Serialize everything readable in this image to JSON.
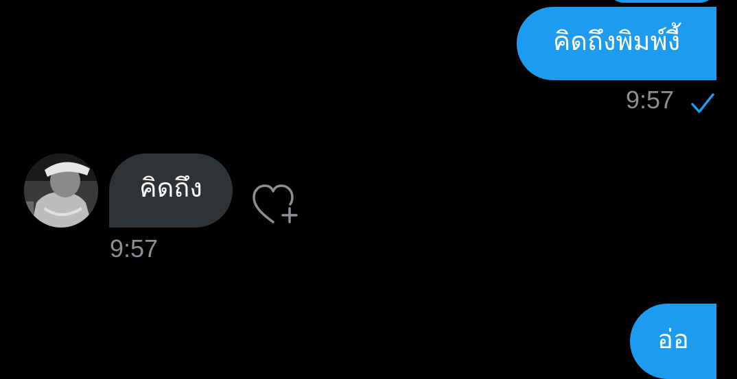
{
  "colors": {
    "background": "#000000",
    "outgoing_bubble": "#1d9bf0",
    "incoming_bubble": "#2f3336",
    "timestamp": "#8b9095",
    "read_check": "#1d9bf0"
  },
  "messages": [
    {
      "direction": "outgoing",
      "text": "คิดถึงพิมพ์งี้",
      "time": "9:57",
      "status_icon": "check-icon"
    },
    {
      "direction": "incoming",
      "text": "คิดถึง",
      "time": "9:57",
      "avatar": "avatar",
      "reaction_icon": "heart-plus-icon"
    },
    {
      "direction": "outgoing",
      "text": "อ่อ"
    }
  ]
}
